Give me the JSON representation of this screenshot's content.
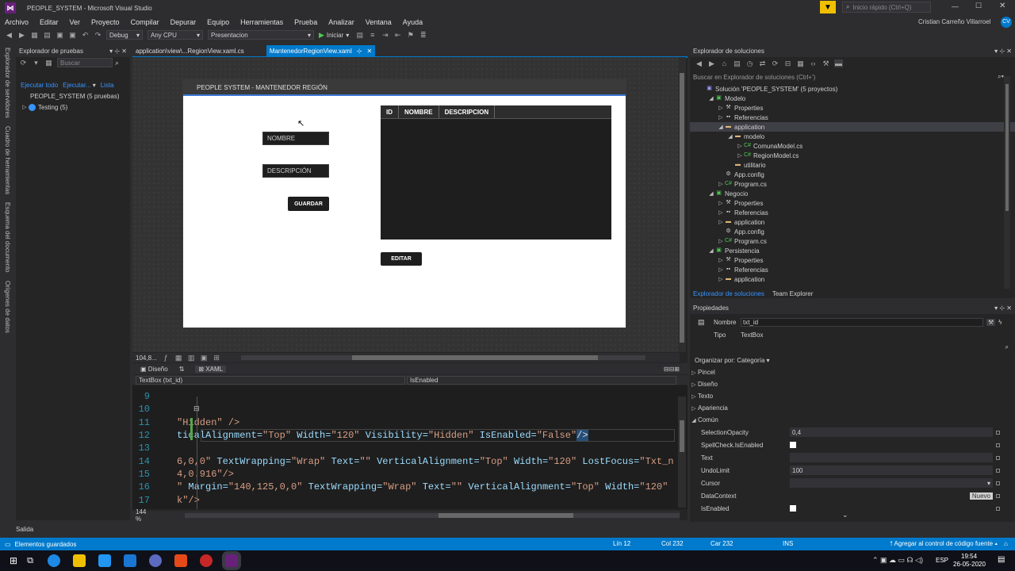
{
  "title": {
    "app_title": "PEOPLE_SYSTEM - Microsoft Visual Studio",
    "quick_launch_placeholder": "Inicio rápido (Ctrl+Q)",
    "user_name": "Cristian Carreño Villarroel",
    "user_initials": "CV"
  },
  "menu": [
    "Archivo",
    "Editar",
    "Ver",
    "Proyecto",
    "Compilar",
    "Depurar",
    "Equipo",
    "Herramientas",
    "Prueba",
    "Analizar",
    "Ventana",
    "Ayuda"
  ],
  "toolbar": {
    "config": "Debug",
    "platform": "Any CPU",
    "project": "Presentacion",
    "start": "Iniciar"
  },
  "left_strip": [
    "Explorador de servidores",
    "Cuadro de herramientas",
    "Esquema del documento",
    "Orígenes de datos"
  ],
  "test_explorer": {
    "title": "Explorador de pruebas",
    "search_placeholder": "Buscar",
    "run_all": "Ejecutar todo",
    "run": "Ejecutar...",
    "list": "Lista",
    "root": "PEOPLE_SYSTEM (5 pruebas)",
    "child": "Testing (5)"
  },
  "tabs": [
    {
      "label": "application\\view\\...RegionView.xaml.cs"
    },
    {
      "label": "MantenedorRegionView.xaml"
    }
  ],
  "designer": {
    "window_title": "PEOPLE SYSTEM - MANTENEDOR REGIÓN",
    "nombre_placeholder": "NOMBRE",
    "descripcion_placeholder": "DESCRIPCIÓN",
    "guardar": "GUARDAR",
    "editar": "EDITAR",
    "columns": [
      "ID",
      "NOMBRE",
      "DESCRIPCION"
    ],
    "zoom": "104,8...",
    "tab_design": "Diseño",
    "tab_xaml": "XAML"
  },
  "code_nav": {
    "left": "TextBox (txt_id)",
    "right": "IsEnabled"
  },
  "code_lines": [
    {
      "num": "9",
      "tokens": []
    },
    {
      "num": "10",
      "tokens": []
    },
    {
      "num": "11",
      "tokens": [
        {
          "t": "\"Hidden\" />",
          "c": "str"
        }
      ]
    },
    {
      "num": "12",
      "tokens": [
        {
          "t": "ticalAlignment=",
          "c": "attr"
        },
        {
          "t": "\"Top\" ",
          "c": "str"
        },
        {
          "t": "Width=",
          "c": "attr"
        },
        {
          "t": "\"120\" ",
          "c": "str"
        },
        {
          "t": "Visibility=",
          "c": "attr"
        },
        {
          "t": "\"Hidden\" ",
          "c": "str"
        },
        {
          "t": "IsEnabled=",
          "c": "attr"
        },
        {
          "t": "\"False\"",
          "c": "str"
        },
        {
          "t": "/>",
          "c": "punc"
        }
      ]
    },
    {
      "num": "13",
      "tokens": []
    },
    {
      "num": "14",
      "tokens": [
        {
          "t": "6,0,0\" ",
          "c": "str"
        },
        {
          "t": "TextWrapping=",
          "c": "attr"
        },
        {
          "t": "\"Wrap\" ",
          "c": "str"
        },
        {
          "t": "Text=",
          "c": "attr"
        },
        {
          "t": "\"\" ",
          "c": "str"
        },
        {
          "t": "VerticalAlignment=",
          "c": "attr"
        },
        {
          "t": "\"Top\" ",
          "c": "str"
        },
        {
          "t": "Width=",
          "c": "attr"
        },
        {
          "t": "\"120\" ",
          "c": "str"
        },
        {
          "t": "LostFocus=",
          "c": "attr"
        },
        {
          "t": "\"Txt_n",
          "c": "str"
        }
      ]
    },
    {
      "num": "15",
      "tokens": [
        {
          "t": "4,0.916\"/>",
          "c": "str"
        }
      ]
    },
    {
      "num": "16",
      "tokens": [
        {
          "t": "\" ",
          "c": "str"
        },
        {
          "t": "Margin=",
          "c": "attr"
        },
        {
          "t": "\"140,125,0,0\" ",
          "c": "str"
        },
        {
          "t": "TextWrapping=",
          "c": "attr"
        },
        {
          "t": "\"Wrap\" ",
          "c": "str"
        },
        {
          "t": "Text=",
          "c": "attr"
        },
        {
          "t": "\"\" ",
          "c": "str"
        },
        {
          "t": "VerticalAlignment=",
          "c": "attr"
        },
        {
          "t": "\"Top\" ",
          "c": "str"
        },
        {
          "t": "Width=",
          "c": "attr"
        },
        {
          "t": "\"120\"",
          "c": "str"
        }
      ]
    },
    {
      "num": "17",
      "tokens": [
        {
          "t": "k\"/>",
          "c": "str"
        }
      ]
    }
  ],
  "editor_zoom": "144 %",
  "solution": {
    "title": "Explorador de soluciones",
    "search": "Buscar en Explorador de soluciones (Ctrl+')",
    "items": [
      {
        "label": "Solución 'PEOPLE_SYSTEM' (5 proyectos)",
        "indent": 0,
        "glyph": "",
        "icon": "sln"
      },
      {
        "label": "Modelo",
        "indent": 1,
        "glyph": "◢",
        "icon": "proj"
      },
      {
        "label": "Properties",
        "indent": 2,
        "glyph": "▷",
        "icon": "wrench"
      },
      {
        "label": "Referencias",
        "indent": 2,
        "glyph": "▷",
        "icon": "ref"
      },
      {
        "label": "application",
        "indent": 2,
        "glyph": "◢",
        "icon": "folder"
      },
      {
        "label": "modelo",
        "indent": 3,
        "glyph": "◢",
        "icon": "folder"
      },
      {
        "label": "ComunaModel.cs",
        "indent": 4,
        "glyph": "▷",
        "icon": "cs"
      },
      {
        "label": "RegionModel.cs",
        "indent": 4,
        "glyph": "▷",
        "icon": "cs"
      },
      {
        "label": "utilitario",
        "indent": 3,
        "glyph": "",
        "icon": "folder"
      },
      {
        "label": "App.config",
        "indent": 2,
        "glyph": "",
        "icon": "config"
      },
      {
        "label": "Program.cs",
        "indent": 2,
        "glyph": "▷",
        "icon": "cs"
      },
      {
        "label": "Negocio",
        "indent": 1,
        "glyph": "◢",
        "icon": "proj"
      },
      {
        "label": "Properties",
        "indent": 2,
        "glyph": "▷",
        "icon": "wrench"
      },
      {
        "label": "Referencias",
        "indent": 2,
        "glyph": "▷",
        "icon": "ref"
      },
      {
        "label": "application",
        "indent": 2,
        "glyph": "▷",
        "icon": "folder"
      },
      {
        "label": "App.config",
        "indent": 2,
        "glyph": "",
        "icon": "config"
      },
      {
        "label": "Program.cs",
        "indent": 2,
        "glyph": "▷",
        "icon": "cs"
      },
      {
        "label": "Persistencia",
        "indent": 1,
        "glyph": "◢",
        "icon": "proj"
      },
      {
        "label": "Properties",
        "indent": 2,
        "glyph": "▷",
        "icon": "wrench"
      },
      {
        "label": "Referencias",
        "indent": 2,
        "glyph": "▷",
        "icon": "ref"
      },
      {
        "label": "application",
        "indent": 2,
        "glyph": "▷",
        "icon": "folder"
      }
    ],
    "tab_solution": "Explorador de soluciones",
    "tab_team": "Team Explorer"
  },
  "properties": {
    "title": "Propiedades",
    "name_label": "Nombre",
    "name_value": "txt_id",
    "type_label": "Tipo",
    "type_value": "TextBox",
    "arrange": "Organizar por: Categoría",
    "categories": [
      "Pincel",
      "Diseño",
      "Texto",
      "Apariencia"
    ],
    "common": "Común",
    "rows": [
      {
        "name": "SelectionOpacity",
        "value": "0,4",
        "kind": "text"
      },
      {
        "name": "SpellCheck.IsEnabled",
        "value": "",
        "kind": "check"
      },
      {
        "name": "Text",
        "value": "",
        "kind": "text"
      },
      {
        "name": "UndoLimit",
        "value": "100",
        "kind": "text"
      },
      {
        "name": "Cursor",
        "value": "",
        "kind": "select"
      },
      {
        "name": "DataContext",
        "value": "Nuevo",
        "kind": "button"
      },
      {
        "name": "IsEnabled",
        "value": "",
        "kind": "check"
      }
    ]
  },
  "output": {
    "label": "Salida"
  },
  "status": {
    "message": "Elementos guardados",
    "ln": "Lín 12",
    "col": "Col 232",
    "car": "Car 232",
    "ins": "INS",
    "source_control": "Agregar al control de código fuente"
  },
  "taskbar": {
    "lang": "ESP",
    "time": "19:54",
    "date": "26-05-2020"
  },
  "colors": {
    "accent": "#007acc",
    "vs_purple": "#68217a"
  }
}
